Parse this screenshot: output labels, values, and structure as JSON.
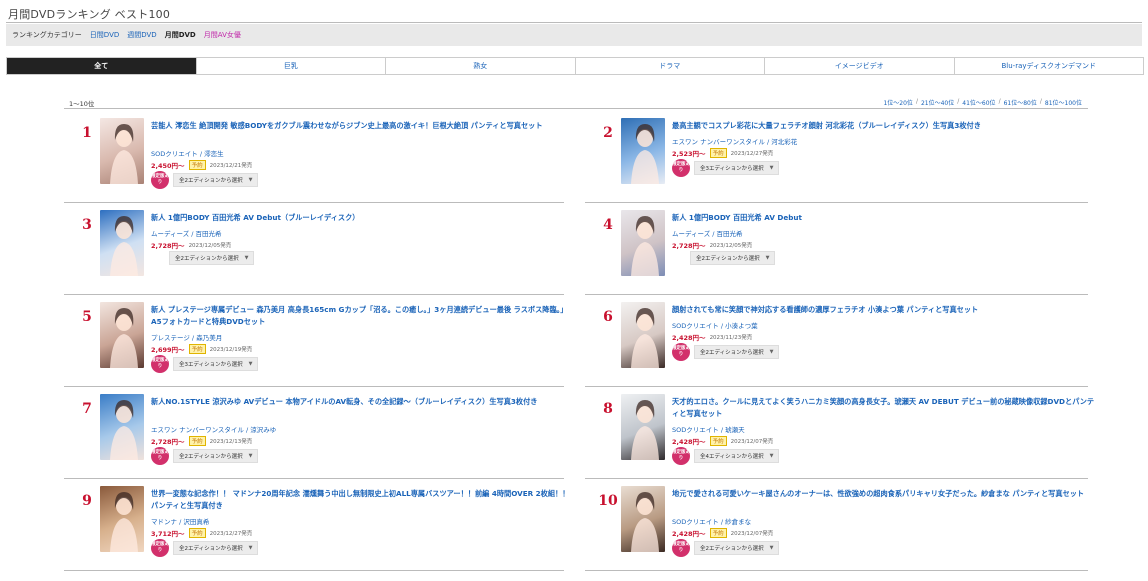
{
  "page_title": "月間DVDランキング ベスト100",
  "catbar": {
    "label": "ランキングカテゴリー",
    "links": [
      {
        "text": "日間DVD",
        "kind": "lnk"
      },
      {
        "text": "週間DVD",
        "kind": "lnk"
      },
      {
        "text": "月間DVD",
        "kind": "cur"
      },
      {
        "text": "月間AV女優",
        "kind": "hot"
      }
    ]
  },
  "tabs": [
    "全て",
    "巨乳",
    "熟女",
    "ドラマ",
    "イメージビデオ",
    "Blu-rayディスクオンデマンド"
  ],
  "range_left": "1〜10位",
  "range_links": [
    "1位〜20位",
    "21位〜40位",
    "41位〜60位",
    "61位〜80位",
    "81位〜100位"
  ],
  "edition_caret": "▼",
  "yoyaku_label": "予約",
  "circle_label": "限定版あり",
  "items": [
    {
      "rank": "1",
      "title": "芸能人 澪恋生 絶頂開発 敏感BODYをガクブル震わせながらジブン史上最高の激イキ！巨根大絶頂 パンティと写真セット",
      "maker": "SODクリエイト / 澪恋生",
      "price": "2,450円〜",
      "yoyaku": true,
      "release": "2023/12/21発売",
      "circle": true,
      "edition": "全2エディションから選択",
      "thumb": [
        "#f4e7e3",
        "#d9b9ae",
        "#a98275"
      ]
    },
    {
      "rank": "2",
      "title": "最高主観でコスプレ彩花に大量フェラチオ顔射 河北彩花（ブルーレイディスク）生写真3枚付き",
      "maker": "エスワン ナンバーワンスタイル / 河北彩花",
      "price": "2,523円〜",
      "yoyaku": true,
      "release": "2023/12/27発売",
      "circle": true,
      "edition": "全3エディションから選択",
      "thumb": [
        "#2f6fb5",
        "#8bb7e6",
        "#e8ecf4"
      ]
    },
    {
      "rank": "3",
      "title": "新人 1億円BODY 百田光希 AV Debut（ブルーレイディスク）",
      "maker": "ムーディーズ / 百田光希",
      "price": "2,728円〜",
      "yoyaku": false,
      "release": "2023/12/05発売",
      "circle": false,
      "edition": "全2エディションから選択",
      "thumb": [
        "#2d6fc0",
        "#cfe0f3",
        "#f3e6e1"
      ]
    },
    {
      "rank": "4",
      "title": "新人 1億円BODY 百田光希 AV Debut",
      "maker": "ムーディーズ / 百田光希",
      "price": "2,728円〜",
      "yoyaku": false,
      "release": "2023/12/05発売",
      "circle": false,
      "edition": "全2エディションから選択",
      "thumb": [
        "#e9e6ea",
        "#cfc3c6",
        "#7d8db5"
      ]
    },
    {
      "rank": "5",
      "title": "新人 プレステージ専属デビュー 森乃美月 高身長165cm Gカップ「沼る。この癒し。」3ヶ月連続デビュー最後 ラスボス降臨。」A5フォトカードと特典DVDセット",
      "maker": "プレステージ / 森乃美月",
      "price": "2,699円〜",
      "yoyaku": true,
      "release": "2023/12/19発売",
      "circle": true,
      "edition": "全3エディションから選択",
      "thumb": [
        "#f2e5df",
        "#caa596",
        "#5b3a31"
      ]
    },
    {
      "rank": "6",
      "title": "顔射されても常に笑顔で神対応する看護師の濃厚フェラチオ 小湊よつ葉 パンティと写真セット",
      "maker": "SODクリエイト / 小湊よつ葉",
      "price": "2,428円〜",
      "yoyaku": false,
      "release": "2023/11/23発売",
      "circle": true,
      "edition": "全2エディションから選択",
      "thumb": [
        "#f3f1f0",
        "#d7c9c4",
        "#3b2b27"
      ]
    },
    {
      "rank": "7",
      "title": "新人NO.1STYLE 涼沢みゆ AVデビュー 本物アイドルのAV転身、その全記録～（ブルーレイディスク）生写真3枚付き",
      "maker": "エスワン ナンバーワンスタイル / 涼沢みゆ",
      "price": "2,728円〜",
      "yoyaku": true,
      "release": "2023/12/13発売",
      "circle": true,
      "edition": "全2エディションから選択",
      "thumb": [
        "#3a7dc7",
        "#a7c9ea",
        "#f0e2dc"
      ]
    },
    {
      "rank": "8",
      "title": "天才的エロさ。クールに見えてよく笑うハニカミ笑顔の高身長女子。琥瀬天 AV DEBUT デビュー前の秘蔵映像収録DVDとパンティと写真セット",
      "maker": "SODクリエイト / 琥瀬天",
      "price": "2,428円〜",
      "yoyaku": true,
      "release": "2023/12/07発売",
      "circle": true,
      "edition": "全4エディションから選択",
      "thumb": [
        "#eef0f2",
        "#bfc4cb",
        "#2e2a2c"
      ]
    },
    {
      "rank": "9",
      "title": "世界一変態な記念作！！ マドンナ20周年記念 濡燻舞う中出し無制限史上初ALL専属バスツアー！！前編 4時間OVER 2枚組！！ パンティと生写真付き",
      "maker": "マドンナ / 沢田真希",
      "price": "3,712円〜",
      "yoyaku": true,
      "release": "2023/12/27発売",
      "circle": true,
      "edition": "全2エディションから選択",
      "thumb": [
        "#8a5a3c",
        "#d7b08c",
        "#f0d6c0"
      ]
    },
    {
      "rank": "10",
      "title": "地元で愛される可愛いケーキ屋さんのオーナーは、性欲強めの超肉食系パリキャリ女子だった。紗倉まな パンティと写真セット",
      "maker": "SODクリエイト / 紗倉まな",
      "price": "2,428円〜",
      "yoyaku": true,
      "release": "2023/12/07発売",
      "circle": true,
      "edition": "全2エディションから選択",
      "thumb": [
        "#e9ddd2",
        "#b89a82",
        "#3b2a22"
      ]
    }
  ]
}
